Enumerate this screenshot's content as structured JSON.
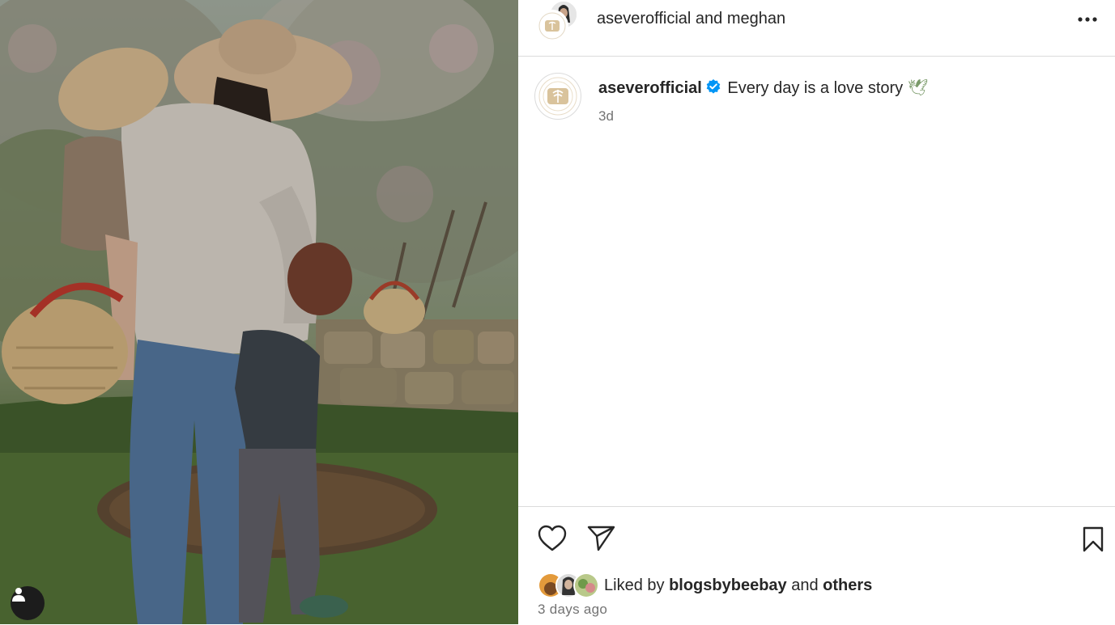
{
  "header": {
    "title_owner": "aseverofficial",
    "title_connector": "and",
    "title_coauthor": "meghan"
  },
  "caption": {
    "username": "aseverofficial",
    "text": "Every day is a love story",
    "emoji": "🕊",
    "time": "3d"
  },
  "likes": {
    "prefix": "Liked by",
    "user": "blogsbybeebay",
    "connector": "and",
    "others": "others"
  },
  "posted_ago": "3 days ago",
  "icons": {
    "more": "more-options-icon",
    "like": "heart-icon",
    "share": "send-icon",
    "save": "bookmark-icon",
    "verified": "verified-badge-icon",
    "tags": "user-tag-icon"
  },
  "colors": {
    "verified_blue": "#0095f6",
    "text_primary": "#262626",
    "text_secondary": "#737373",
    "divider": "#dbdbdb"
  }
}
